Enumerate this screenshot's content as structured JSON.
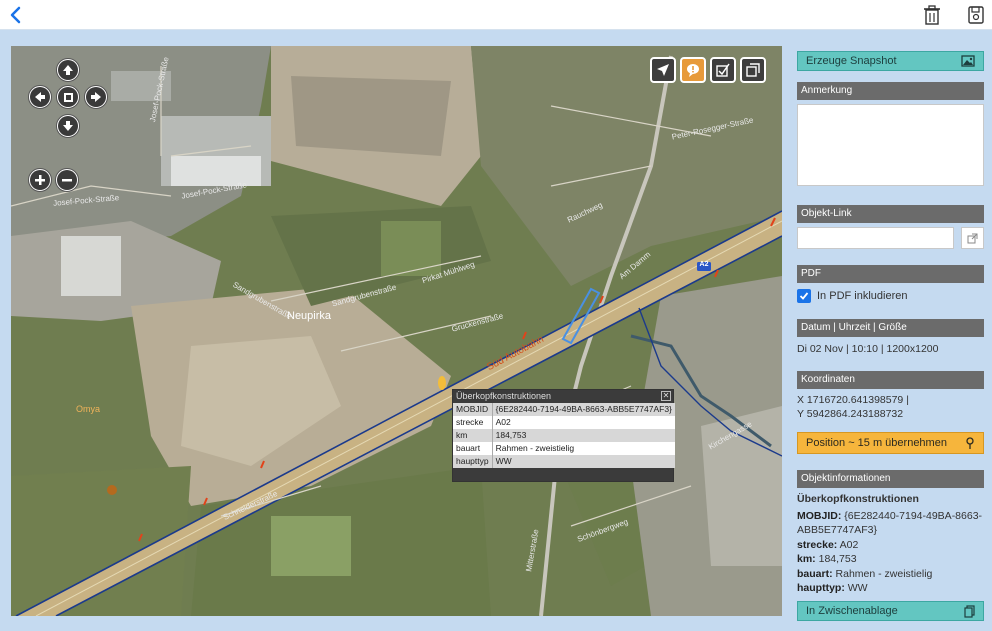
{
  "toolbar": {
    "back_icon": "chevron-left-icon",
    "delete_icon": "trash-icon",
    "save_icon": "save-icon"
  },
  "map": {
    "street_labels": {
      "josef_pock_1": "Josef-Pock-Straße",
      "josef_pock_2": "Josef-Pock-Straße",
      "josef_pock_3": "Josef-Pock-Straße",
      "sandgruben": "Sandgrubenstraße",
      "sandgruben2": "Sandgrubenstraße",
      "neupirka": "Neupirka",
      "sued_autobahn": "Süd Autobahn",
      "pirkat": "Pirkat Mühlweg",
      "a2_shield": "A2",
      "kirchengasse": "Kirchengasse",
      "mitterstrasse": "Mitterstraße",
      "schonbergweg": "Schönbergweg",
      "schneiderstrasse": "Schneiderstraße",
      "omya": "Omya",
      "am_damm": "Am Damm",
      "peter_rosegger": "Peter-Rosegger-Straße",
      "gruckenstrasse": "Gruckenstraße",
      "rauchweg": "Rauchweg"
    },
    "tools": {
      "locate": "navigation-arrow-icon",
      "annotate": "comment-icon",
      "check": "checklist-icon",
      "layers": "layers-icon"
    },
    "nav_icons": {
      "up": "arrow-up-icon",
      "left": "arrow-left-icon",
      "right": "arrow-right-icon",
      "down": "arrow-down-icon",
      "zoom_in": "plus-icon",
      "zoom_out": "minus-icon"
    },
    "popup": {
      "title": "Überkopfkonstruktionen",
      "close": "✕",
      "rows": [
        {
          "key": "MOBJID",
          "value": "{6E282440-7194-49BA-8663-ABB5E7747AF3}"
        },
        {
          "key": "strecke",
          "value": "A02"
        },
        {
          "key": "km",
          "value": "184,753"
        },
        {
          "key": "bauart",
          "value": "Rahmen - zweistielig"
        },
        {
          "key": "haupttyp",
          "value": "WW"
        }
      ]
    }
  },
  "panel": {
    "snapshot_button": "Erzeuge Snapshot",
    "anmerkung_label": "Anmerkung",
    "anmerkung_value": "",
    "objektlink_label": "Objekt-Link",
    "objektlink_value": "",
    "pdf_label": "PDF",
    "pdf_checkbox_label": "In PDF inkludieren",
    "pdf_checked": true,
    "datetime_label": "Datum | Uhrzeit | Größe",
    "datetime_value": "Di 02 Nov | 10:10 | 1200x1200",
    "coords_label": "Koordinaten",
    "coords_x": "X 1716720.641398579 |",
    "coords_y": "Y 5942864.243188732",
    "position_button": "Position ~ 15 m übernehmen",
    "objinfo_label": "Objektinformationen",
    "objinfo_title": "Überkopfkonstruktionen",
    "objinfo": {
      "mobjid_key": "MOBJID:",
      "mobjid_value": "{6E282440-7194-49BA-8663-ABB5E7747AF3}",
      "strecke_key": "strecke:",
      "strecke_value": "A02",
      "km_key": "km:",
      "km_value": "184,753",
      "bauart_key": "bauart:",
      "bauart_value": "Rahmen - zweistielig",
      "haupttyp_key": "haupttyp:",
      "haupttyp_value": "WW"
    },
    "clipboard_button": "In Zwischenablage"
  },
  "colors": {
    "accent_teal": "#63c6c1",
    "accent_orange": "#f6b53c",
    "section_gray": "#6b6b6b",
    "page_bg": "#c5daf0"
  }
}
